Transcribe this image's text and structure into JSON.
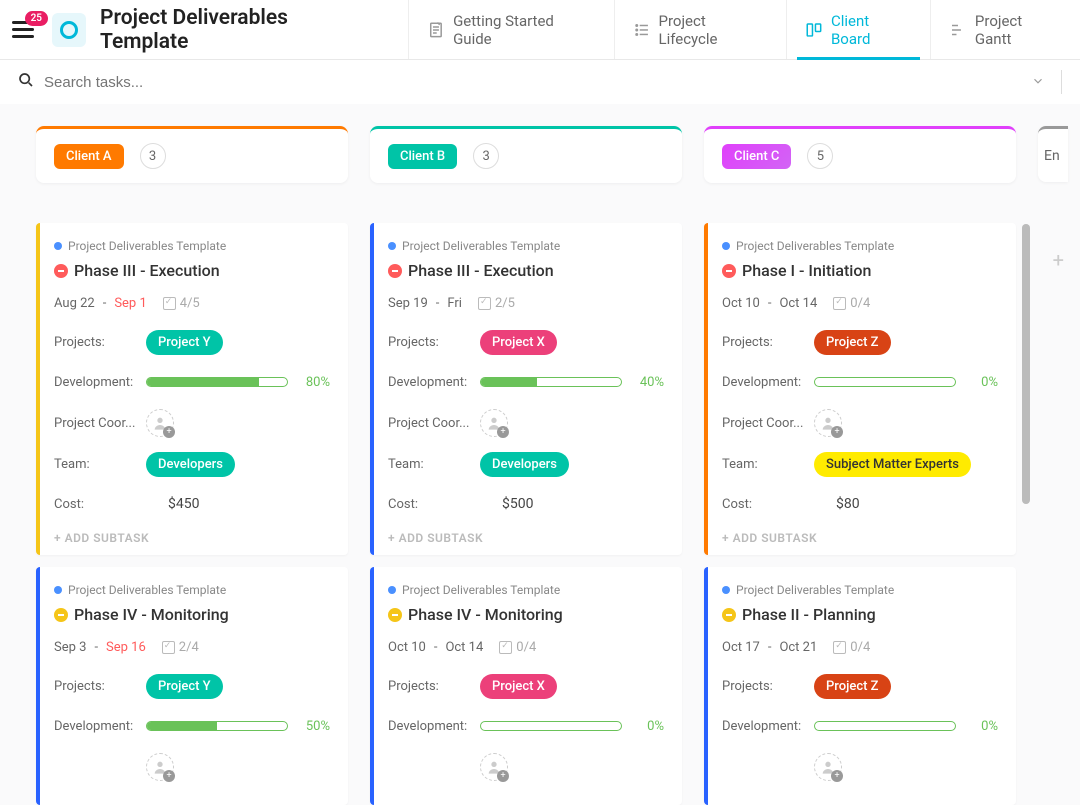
{
  "header": {
    "badge": "25",
    "title": "Project Deliverables Template",
    "tabs": [
      {
        "label": "Getting Started Guide"
      },
      {
        "label": "Project Lifecycle"
      },
      {
        "label": "Client Board"
      },
      {
        "label": "Project Gantt"
      }
    ]
  },
  "search": {
    "placeholder": "Search tasks..."
  },
  "columns": [
    {
      "name": "Client A",
      "count": "3",
      "colorClass": "orange"
    },
    {
      "name": "Client B",
      "count": "3",
      "colorClass": "teal"
    },
    {
      "name": "Client C",
      "count": "5",
      "colorClass": "pink"
    }
  ],
  "extraColumnPeek": "En",
  "cards": {
    "a1": {
      "crumb": "Project Deliverables Template",
      "title": "Phase III - Execution",
      "statusClass": "red",
      "date1": "Aug 22",
      "date2": "Sep 1",
      "date2Red": true,
      "checks": "4/5",
      "projectsLabel": "Projects:",
      "projectPill": "Project Y",
      "projectPillClass": "teal",
      "devLabel": "Development:",
      "devPct": 80,
      "coordLabel": "Project Coor...",
      "teamLabel": "Team:",
      "teamPill": "Developers",
      "teamPillClass": "teal",
      "costLabel": "Cost:",
      "cost": "$450",
      "addSubtask": "+ ADD SUBTASK",
      "stripe": "yellow"
    },
    "a2": {
      "crumb": "Project Deliverables Template",
      "title": "Phase IV - Monitoring",
      "statusClass": "yellow",
      "date1": "Sep 3",
      "date2": "Sep 16",
      "date2Red": true,
      "checks": "2/4",
      "projectsLabel": "Projects:",
      "projectPill": "Project Y",
      "projectPillClass": "teal",
      "devLabel": "Development:",
      "devPct": 50,
      "stripe": "blue"
    },
    "b1": {
      "crumb": "Project Deliverables Template",
      "title": "Phase III - Execution",
      "statusClass": "red",
      "date1": "Sep 19",
      "date2": "Fri",
      "date2Red": false,
      "checks": "2/5",
      "projectsLabel": "Projects:",
      "projectPill": "Project X",
      "projectPillClass": "pink",
      "devLabel": "Development:",
      "devPct": 40,
      "coordLabel": "Project Coor...",
      "teamLabel": "Team:",
      "teamPill": "Developers",
      "teamPillClass": "teal",
      "costLabel": "Cost:",
      "cost": "$500",
      "addSubtask": "+ ADD SUBTASK",
      "stripe": "blue"
    },
    "b2": {
      "crumb": "Project Deliverables Template",
      "title": "Phase IV - Monitoring",
      "statusClass": "yellow",
      "date1": "Oct 10",
      "date2": "Oct 14",
      "date2Red": false,
      "checks": "0/4",
      "projectsLabel": "Projects:",
      "projectPill": "Project X",
      "projectPillClass": "pink",
      "devLabel": "Development:",
      "devPct": 0,
      "stripe": "blue"
    },
    "c1": {
      "crumb": "Project Deliverables Template",
      "title": "Phase I - Initiation",
      "statusClass": "red",
      "date1": "Oct 10",
      "date2": "Oct 14",
      "date2Red": false,
      "checks": "0/4",
      "projectsLabel": "Projects:",
      "projectPill": "Project Z",
      "projectPillClass": "darkorange",
      "devLabel": "Development:",
      "devPct": 0,
      "coordLabel": "Project Coor...",
      "teamLabel": "Team:",
      "teamPill": "Subject Matter Experts",
      "teamPillClass": "yellow",
      "costLabel": "Cost:",
      "cost": "$80",
      "addSubtask": "+ ADD SUBTASK",
      "stripe": "orange"
    },
    "c2": {
      "crumb": "Project Deliverables Template",
      "title": "Phase II - Planning",
      "statusClass": "yellow",
      "date1": "Oct 17",
      "date2": "Oct 21",
      "date2Red": false,
      "checks": "0/4",
      "projectsLabel": "Projects:",
      "projectPill": "Project Z",
      "projectPillClass": "darkorange",
      "devLabel": "Development:",
      "devPct": 0,
      "stripe": "blue"
    }
  }
}
